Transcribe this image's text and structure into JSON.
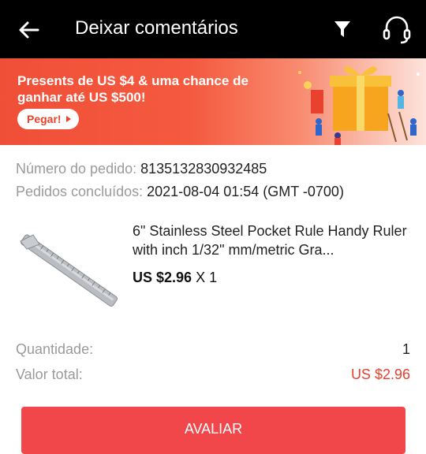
{
  "header": {
    "title": "Deixar comentários",
    "back_icon": "arrow-left-icon",
    "filter_icon": "filter-icon",
    "support_icon": "headset-icon"
  },
  "banner": {
    "text": "Presents de  US $4 & uma chance de ganhar até US $500!",
    "button_label": "Pegar!"
  },
  "order": {
    "number_label": "Número do pedido:",
    "number_value": "8135132830932485",
    "completed_label": "Pedidos concluídos:",
    "completed_value": "2021-08-04 01:54 (GMT -0700)"
  },
  "product": {
    "name": "6\" Stainless Steel Pocket Rule Handy Ruler with inch 1/32\" mm/metric Gra...",
    "price": "US $2.96",
    "quantity_text": "X 1"
  },
  "summary": {
    "quantity_label": "Quantidade:",
    "quantity_value": "1",
    "total_label": "Valor total:",
    "total_value": "US $2.96"
  },
  "action": {
    "review_label": "AVALIAR"
  },
  "colors": {
    "accent": "#f2474a",
    "price_red": "#e8412d",
    "header_bg": "#000000"
  }
}
